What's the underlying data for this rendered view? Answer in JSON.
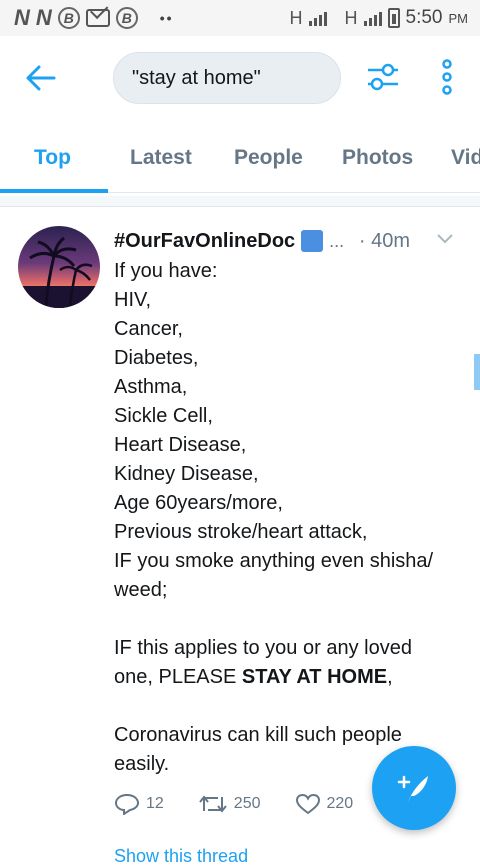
{
  "status_bar": {
    "left_icons": [
      "N",
      "N",
      "B",
      "mail",
      "B"
    ],
    "network_1": "H",
    "network_2": "H",
    "time": "5:50",
    "meridiem": "PM"
  },
  "header": {
    "search_value": "\"stay at home\""
  },
  "tabs": [
    {
      "label": "Top",
      "active": true
    },
    {
      "label": "Latest",
      "active": false
    },
    {
      "label": "People",
      "active": false
    },
    {
      "label": "Photos",
      "active": false
    },
    {
      "label": "Vid",
      "active": false
    }
  ],
  "tweet": {
    "author": "#OurFavOnlineDoc",
    "ellipsis": "...",
    "time": "· 40m",
    "lines": [
      "If you have:",
      "HIV,",
      "Cancer,",
      "Diabetes,",
      "Asthma,",
      "Sickle Cell,",
      "Heart Disease,",
      "Kidney Disease,",
      "Age 60years/more,",
      "Previous stroke/heart attack,",
      "IF you smoke anything even shisha/",
      "weed;"
    ],
    "para2_line1": "IF this applies to you or any loved",
    "para2_line2_prefix": "one, PLEASE ",
    "para2_line2_bold": "STAY AT HOME",
    "para2_line2_suffix": ",",
    "para3_line1": "Coronavirus can kill such people",
    "para3_line2": "easily.",
    "replies": "12",
    "retweets": "250",
    "likes": "220",
    "show_thread": "Show this thread"
  },
  "colors": {
    "accent": "#1da1f2",
    "muted": "#657786",
    "text": "#14171a"
  }
}
